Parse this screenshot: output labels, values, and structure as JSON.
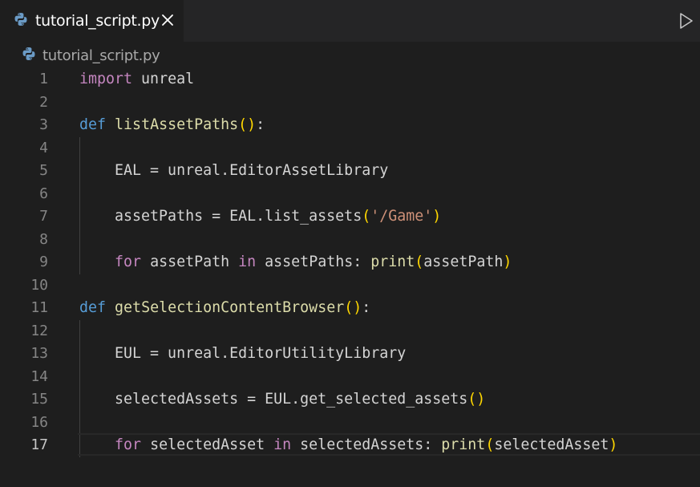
{
  "tab": {
    "label": "tutorial_script.py",
    "close_icon": "close-icon",
    "file_icon": "python-icon"
  },
  "toolbar": {
    "run_icon": "play-icon"
  },
  "breadcrumb": {
    "label": "tutorial_script.py"
  },
  "editor": {
    "active_line": 17,
    "lines": [
      {
        "n": "1",
        "tokens": [
          {
            "t": "import",
            "c": "kw"
          },
          {
            "t": " unreal",
            "c": "plain"
          }
        ]
      },
      {
        "n": "2",
        "tokens": []
      },
      {
        "n": "3",
        "tokens": [
          {
            "t": "def",
            "c": "kw-def"
          },
          {
            "t": " ",
            "c": "plain"
          },
          {
            "t": "listAssetPaths",
            "c": "fn"
          },
          {
            "t": "()",
            "c": "paren"
          },
          {
            "t": ":",
            "c": "plain"
          }
        ]
      },
      {
        "n": "4",
        "tokens": []
      },
      {
        "n": "5",
        "tokens": [
          {
            "t": "    EAL = unreal.EditorAssetLibrary",
            "c": "plain"
          }
        ]
      },
      {
        "n": "6",
        "tokens": []
      },
      {
        "n": "7",
        "tokens": [
          {
            "t": "    assetPaths = EAL.list_assets",
            "c": "plain"
          },
          {
            "t": "(",
            "c": "paren"
          },
          {
            "t": "'/Game'",
            "c": "str"
          },
          {
            "t": ")",
            "c": "paren"
          }
        ]
      },
      {
        "n": "8",
        "tokens": []
      },
      {
        "n": "9",
        "tokens": [
          {
            "t": "    ",
            "c": "plain"
          },
          {
            "t": "for",
            "c": "kw"
          },
          {
            "t": " assetPath ",
            "c": "plain"
          },
          {
            "t": "in",
            "c": "kw"
          },
          {
            "t": " assetPaths: ",
            "c": "plain"
          },
          {
            "t": "print",
            "c": "fn"
          },
          {
            "t": "(",
            "c": "paren"
          },
          {
            "t": "assetPath",
            "c": "plain"
          },
          {
            "t": ")",
            "c": "paren"
          }
        ]
      },
      {
        "n": "10",
        "tokens": []
      },
      {
        "n": "11",
        "tokens": [
          {
            "t": "def",
            "c": "kw-def"
          },
          {
            "t": " ",
            "c": "plain"
          },
          {
            "t": "getSelectionContentBrowser",
            "c": "fn"
          },
          {
            "t": "()",
            "c": "paren"
          },
          {
            "t": ":",
            "c": "plain"
          }
        ]
      },
      {
        "n": "12",
        "tokens": []
      },
      {
        "n": "13",
        "tokens": [
          {
            "t": "    EUL = unreal.EditorUtilityLibrary",
            "c": "plain"
          }
        ]
      },
      {
        "n": "14",
        "tokens": []
      },
      {
        "n": "15",
        "tokens": [
          {
            "t": "    selectedAssets = EUL.get_selected_assets",
            "c": "plain"
          },
          {
            "t": "()",
            "c": "paren"
          }
        ]
      },
      {
        "n": "16",
        "tokens": []
      },
      {
        "n": "17",
        "tokens": [
          {
            "t": "    ",
            "c": "plain"
          },
          {
            "t": "for",
            "c": "kw"
          },
          {
            "t": " selectedAsset ",
            "c": "plain"
          },
          {
            "t": "in",
            "c": "kw"
          },
          {
            "t": " selectedAssets: ",
            "c": "plain"
          },
          {
            "t": "print",
            "c": "fn"
          },
          {
            "t": "(",
            "c": "paren"
          },
          {
            "t": "selectedAsset",
            "c": "plain"
          },
          {
            "t": ")",
            "c": "paren"
          }
        ]
      }
    ]
  },
  "colors": {
    "background": "#1e1e1e",
    "tabbar": "#252526",
    "keyword": "#c586c0",
    "def": "#569cd6",
    "function": "#dcdcaa",
    "string": "#ce9178",
    "bracket": "#ffd700",
    "text": "#d4d4d4"
  }
}
